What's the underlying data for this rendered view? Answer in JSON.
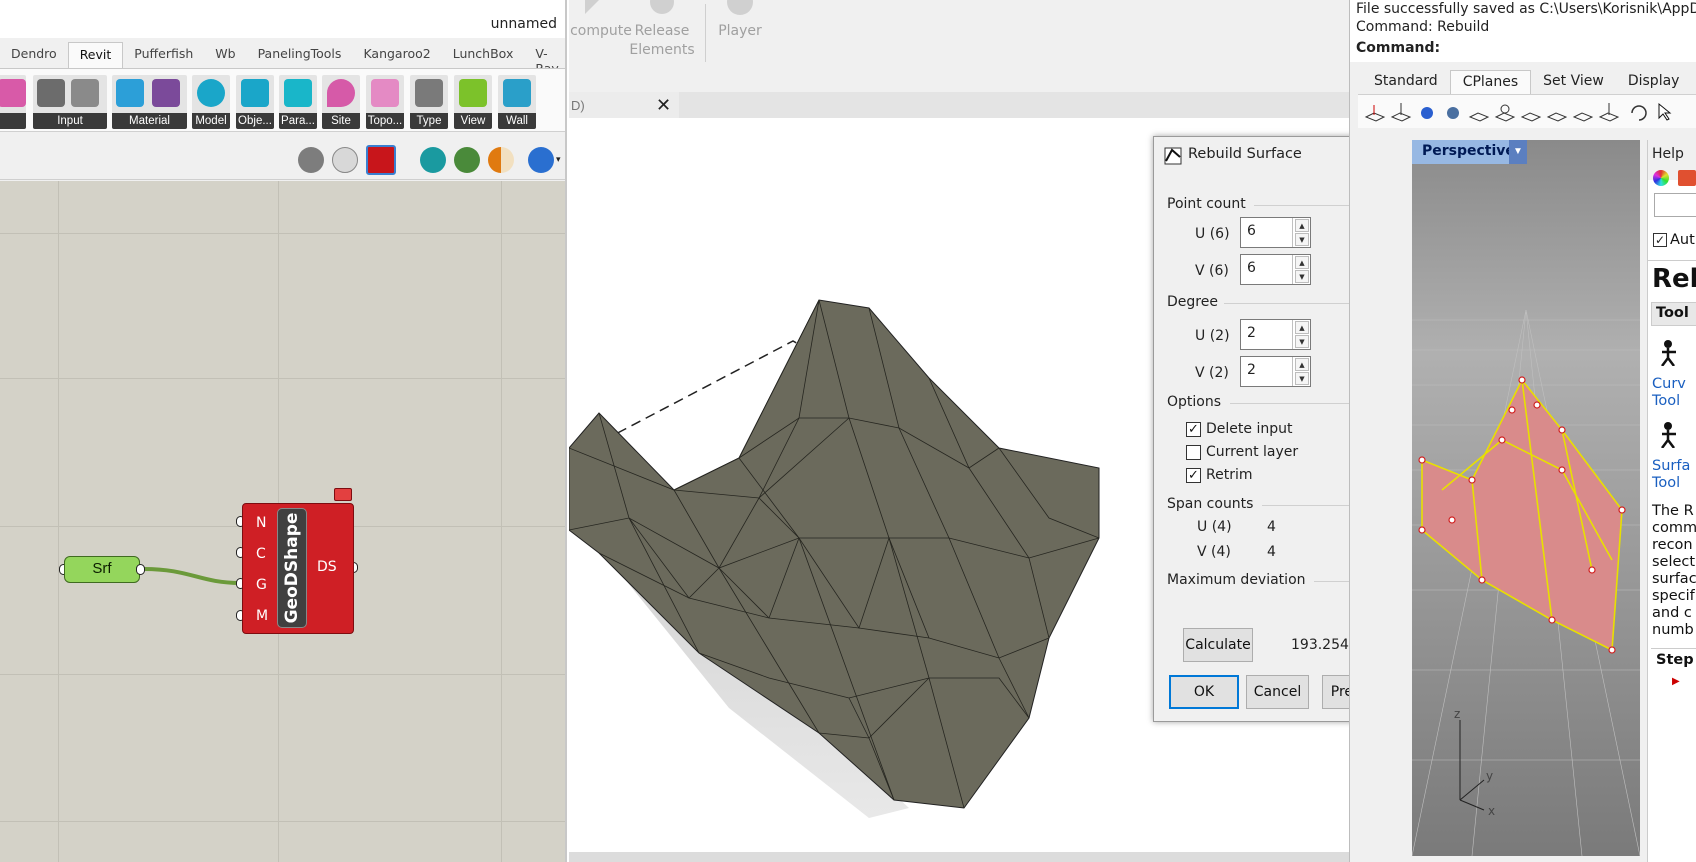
{
  "grasshopper": {
    "doc_name": "unnamed",
    "tabs": [
      "Dendro",
      "Revit",
      "Pufferfish",
      "Wb",
      "PanelingTools",
      "Kangaroo2",
      "LunchBox",
      "V-Ray"
    ],
    "active_tab": "Revit",
    "ribbon_groups": [
      {
        "label": "",
        "name": "prev"
      },
      {
        "label": "Input",
        "name": "input"
      },
      {
        "label": "Material",
        "name": "material"
      },
      {
        "label": "Model",
        "name": "model"
      },
      {
        "label": "Obje...",
        "name": "object"
      },
      {
        "label": "Para...",
        "name": "parameter"
      },
      {
        "label": "Site",
        "name": "site"
      },
      {
        "label": "Topo...",
        "name": "topography"
      },
      {
        "label": "Type",
        "name": "type"
      },
      {
        "label": "View",
        "name": "view"
      },
      {
        "label": "Wall",
        "name": "wall"
      }
    ],
    "components": {
      "srf": {
        "label": "Srf"
      },
      "geodshape": {
        "name": "GeoDShape",
        "inputs": [
          "N",
          "C",
          "G",
          "M"
        ],
        "output": "DS"
      }
    }
  },
  "rhino": {
    "toolbar_commands": [
      {
        "line1": "compute",
        "line2": ""
      },
      {
        "line1": "Release",
        "line2": "Elements"
      },
      {
        "line1": "Player",
        "line2": ""
      }
    ],
    "viewport_tab": {
      "label": "D)",
      "close_icon": "close-icon"
    },
    "command_history": [
      "File successfully saved as C:\\Users\\Korisnik\\AppData",
      "Command: Rebuild",
      "Command:"
    ],
    "side_tabs": [
      "Standard",
      "CPlanes",
      "Set View",
      "Display"
    ],
    "active_side_tab": "CPlanes",
    "perspective_label": "Perspective",
    "help": {
      "tab_label": "Help",
      "checkbox_text": "Aut",
      "title": "Rel",
      "section": "Tool",
      "link1": [
        "Curv",
        "Tool"
      ],
      "link2": [
        "Surfa",
        "Tool"
      ],
      "body": [
        "The R",
        "comm",
        "recon",
        "select",
        "surfac",
        "specif",
        "and c",
        "numb"
      ],
      "steps": "Step"
    },
    "axis_labels": {
      "x": "x",
      "y": "y",
      "z": "z"
    }
  },
  "dialog": {
    "title": "Rebuild Surface",
    "point_count": {
      "label": "Point count",
      "u_label": "U (6)",
      "u_value": "6",
      "v_label": "V (6)",
      "v_value": "6"
    },
    "degree": {
      "label": "Degree",
      "u_label": "U (2)",
      "u_value": "2",
      "v_label": "V (2)",
      "v_value": "2"
    },
    "options": {
      "label": "Options",
      "items": [
        {
          "label": "Delete input",
          "checked": true
        },
        {
          "label": "Current layer",
          "checked": false
        },
        {
          "label": "Retrim",
          "checked": true
        }
      ]
    },
    "span_counts": {
      "label": "Span counts",
      "u_label": "U (4)",
      "u_value": "4",
      "v_label": "V (4)",
      "v_value": "4"
    },
    "max_deviation": {
      "label": "Maximum deviation",
      "calculate_label": "Calculate",
      "value": "193.254"
    },
    "buttons": {
      "ok": "OK",
      "cancel": "Cancel",
      "preview": "Preview"
    }
  },
  "colors": {
    "component_red": "#cf1f25",
    "param_green": "#94d65c",
    "mesh_gray": "#6b6a5c",
    "surface_pink": "#d98b8b",
    "control_yellow": "#e8e000",
    "accent_blue": "#0078d7"
  }
}
